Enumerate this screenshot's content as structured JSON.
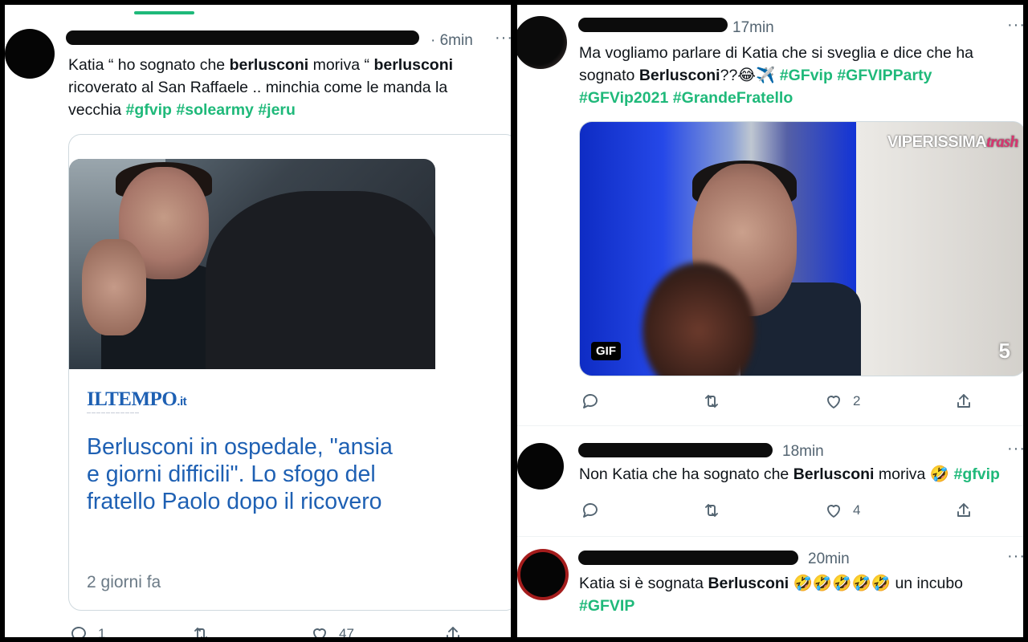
{
  "left": {
    "tweet": {
      "time": "· 6min",
      "text": [
        {
          "t": "Katia “ ho sognato che "
        },
        {
          "b": "berlusconi"
        },
        {
          "t": " moriva “ "
        },
        {
          "b": "berlusconi"
        },
        {
          "t": " ricoverato al San Raffaele .. minchia come le manda la vecchia "
        },
        {
          "h": "#gfvip"
        },
        {
          "t": " "
        },
        {
          "h": "#solearmy"
        },
        {
          "t": " "
        },
        {
          "h": "#jeru"
        }
      ],
      "card": {
        "logo": "ILTEMPO",
        "logo_suffix": ".it",
        "title": "Berlusconi in ospedale, \"ansia e giorni difficili\". Lo sfogo del fratello Paolo dopo il ricovero",
        "date": "2 giorni fa"
      },
      "actions": {
        "reply": "1",
        "retweet": "",
        "like": "47"
      }
    }
  },
  "right": {
    "tweets": [
      {
        "time": "17min",
        "text": [
          {
            "t": "Ma vogliamo parlare di Katia che si sveglia e dice che ha sognato "
          },
          {
            "b": "Berlusconi"
          },
          {
            "t": "??😂✈️ "
          },
          {
            "h": "#GFvip"
          },
          {
            "t": " "
          },
          {
            "h": "#GFVIPParty"
          },
          {
            "t": " "
          },
          {
            "h": "#GFVip2021"
          },
          {
            "t": " "
          },
          {
            "h": "#GrandeFratello"
          }
        ],
        "media": {
          "watermark": "VIPERISSIMA",
          "watermark_suffix": "trash",
          "badge": "GIF",
          "channel": "5"
        },
        "actions": {
          "reply": "",
          "retweet": "",
          "like": "2"
        }
      },
      {
        "time": "18min",
        "text": [
          {
            "t": "Non Katia che ha sognato che "
          },
          {
            "b": "Berlusconi"
          },
          {
            "t": " moriva 🤣 "
          },
          {
            "h": "#gfvip"
          }
        ],
        "actions": {
          "reply": "",
          "retweet": "",
          "like": "4"
        }
      },
      {
        "time": "20min",
        "text": [
          {
            "t": "Katia si è sognata "
          },
          {
            "b": "Berlusconi"
          },
          {
            "t": " 🤣🤣🤣🤣🤣 un incubo "
          },
          {
            "h": "#GFVIP"
          }
        ]
      }
    ]
  },
  "colors": {
    "hashtag": "#1fb97a",
    "link": "#1e60b3",
    "muted": "#536471"
  },
  "icons": [
    "reply-icon",
    "retweet-icon",
    "like-icon",
    "share-icon",
    "more-icon"
  ]
}
